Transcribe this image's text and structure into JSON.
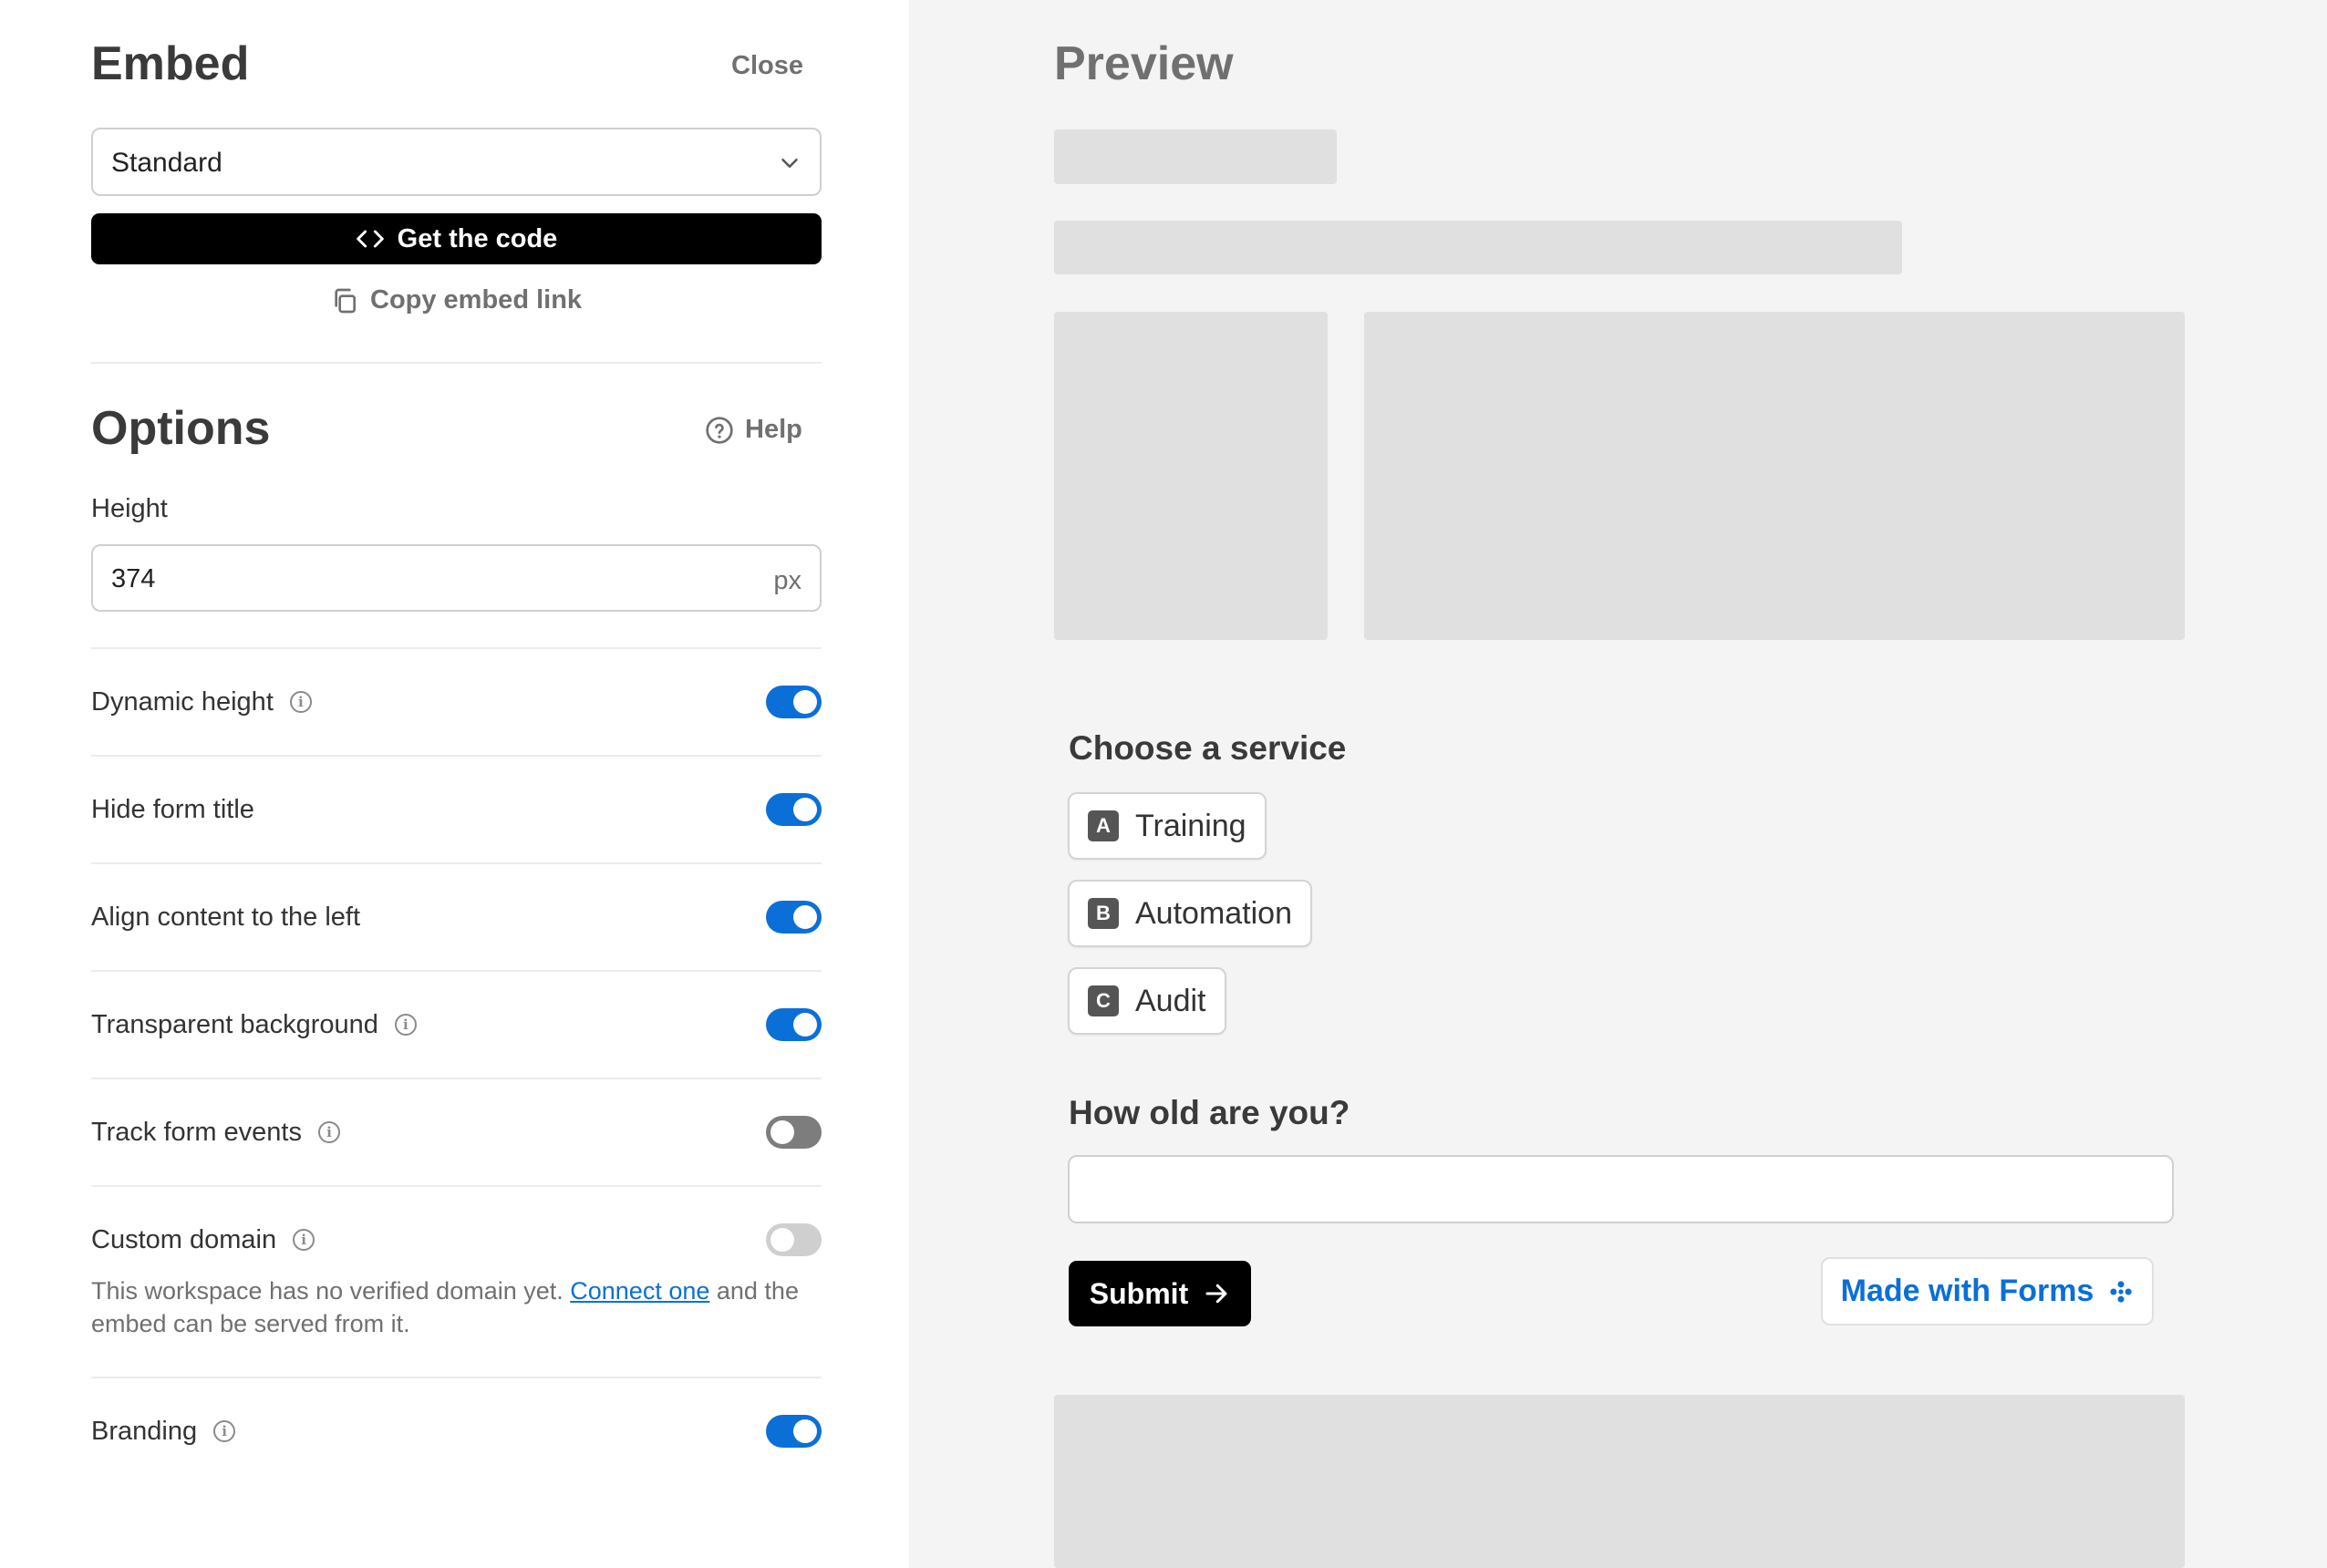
{
  "embed": {
    "title": "Embed",
    "close_label": "Close",
    "mode_value": "Standard",
    "get_code_label": "Get the code",
    "copy_link_label": "Copy embed link"
  },
  "options": {
    "title": "Options",
    "help_label": "Help",
    "height_label": "Height",
    "height_value": "374",
    "height_unit": "px",
    "items": [
      {
        "label": "Dynamic height",
        "info": true,
        "state": "on"
      },
      {
        "label": "Hide form title",
        "info": false,
        "state": "on"
      },
      {
        "label": "Align content to the left",
        "info": false,
        "state": "on"
      },
      {
        "label": "Transparent background",
        "info": true,
        "state": "on"
      },
      {
        "label": "Track form events",
        "info": true,
        "state": "off"
      },
      {
        "label": "Custom domain",
        "info": true,
        "state": "disabled"
      },
      {
        "label": "Branding",
        "info": true,
        "state": "on"
      }
    ],
    "domain_note_before": "This workspace has no verified domain yet. ",
    "domain_note_link": "Connect one",
    "domain_note_after": " and the embed can be served from it."
  },
  "preview": {
    "title": "Preview",
    "q1": "Choose a service",
    "choices": [
      {
        "key": "A",
        "label": "Training"
      },
      {
        "key": "B",
        "label": "Automation"
      },
      {
        "key": "C",
        "label": "Audit"
      }
    ],
    "q2": "How old are you?",
    "age_value": "",
    "submit_label": "Submit",
    "made_with_label": "Made with Forms"
  },
  "colors": {
    "accent": "#0b6fd8",
    "toggle_off": "#7d7d7d",
    "toggle_disabled": "#cfcfcf",
    "placeholder": "#e0e0e0"
  },
  "icons": [
    "chevron-down-icon",
    "code-icon",
    "copy-icon",
    "help-circle-icon",
    "info-icon",
    "arrow-right-icon",
    "sparkle-icon"
  ]
}
